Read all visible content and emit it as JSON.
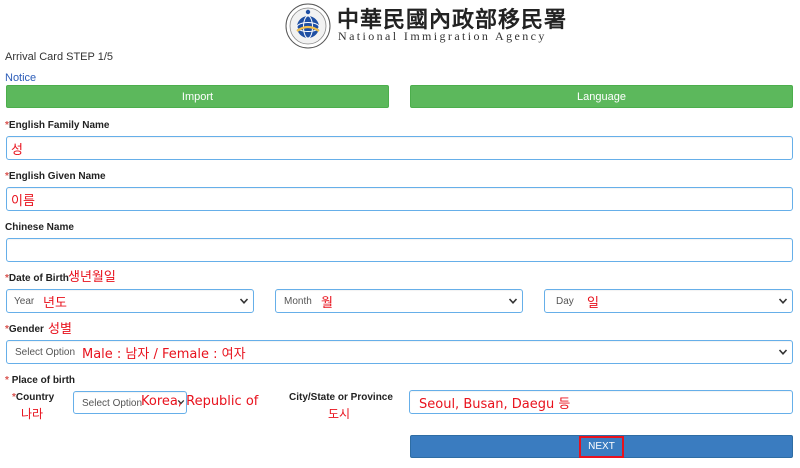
{
  "header": {
    "agency_chinese": "中華民國內政部移民署",
    "agency_english": "National Immigration Agency",
    "emblem_icon": "immigration-agency-emblem-icon"
  },
  "step_title": "Arrival Card STEP 1/5",
  "notice_link": "Notice",
  "buttons": {
    "import": "Import",
    "language": "Language",
    "next": "NEXT"
  },
  "colors": {
    "green_button": "#5cb85c",
    "blue_button": "#3a7cc0",
    "annotation_red": "#e8121d",
    "field_border": "#66afe9"
  },
  "fields": {
    "family_name": {
      "label": "English Family Name",
      "required_mark": "*",
      "annotation": "성"
    },
    "given_name": {
      "label": "English Given Name",
      "required_mark": "*",
      "annotation": "이름"
    },
    "chinese_name": {
      "label": "Chinese Name"
    },
    "date_of_birth": {
      "label": "Date of Birth",
      "required_mark": "*",
      "annotation": "생년월일",
      "year": {
        "value": "Year",
        "annotation": "년도"
      },
      "month": {
        "value": "Month",
        "annotation": "월"
      },
      "day": {
        "value": "Day",
        "annotation": "일"
      }
    },
    "gender": {
      "label": "Gender",
      "required_mark": "*",
      "annotation": "성별",
      "value": "Select Option",
      "value_annotation": "Male : 남자 / Female : 여자"
    },
    "place_of_birth": {
      "label": "Place of birth",
      "required_mark": "*",
      "country": {
        "label": "Country",
        "required_mark": "*",
        "annotation": "나라",
        "value": "Select Option",
        "value_annotation": "Korea, Republic of"
      },
      "city": {
        "label": "City/State or Province",
        "annotation": "도시",
        "value_annotation": "Seoul, Busan, Daegu 등"
      }
    }
  }
}
